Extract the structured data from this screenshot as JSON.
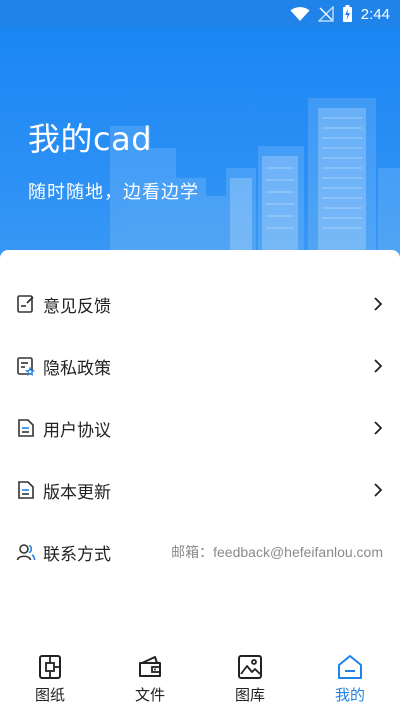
{
  "status_bar": {
    "time": "2:44"
  },
  "hero": {
    "title": "我的cad",
    "subtitle": "随时随地，边看边学"
  },
  "menu": {
    "items": [
      {
        "label": "意见反馈",
        "icon": "feedback-icon"
      },
      {
        "label": "隐私政策",
        "icon": "privacy-icon"
      },
      {
        "label": "用户协议",
        "icon": "user-agreement-icon"
      },
      {
        "label": "版本更新",
        "icon": "version-update-icon"
      }
    ],
    "contact": {
      "label": "联系方式",
      "value": "邮箱：feedback@hefeifanlou.com",
      "icon": "contact-icon"
    }
  },
  "tabbar": {
    "tabs": [
      {
        "label": "图纸",
        "icon": "drawing-icon"
      },
      {
        "label": "文件",
        "icon": "wallet-file-icon"
      },
      {
        "label": "图库",
        "icon": "gallery-icon"
      },
      {
        "label": "我的",
        "icon": "home-icon"
      }
    ],
    "active_color": "#1f83ea"
  },
  "colors": {
    "brand": "#1f83ea",
    "text": "#222222",
    "muted": "#8a8a8a"
  }
}
